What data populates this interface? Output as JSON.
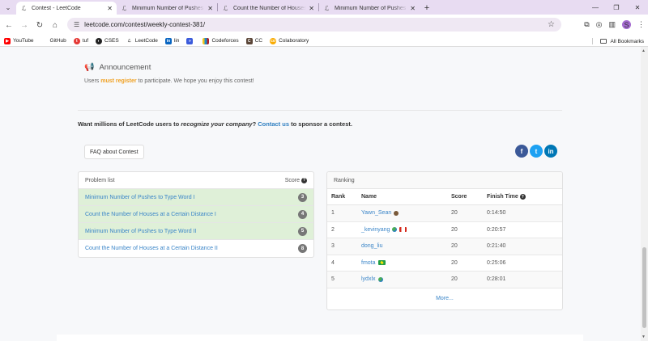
{
  "browser": {
    "tabs": [
      {
        "title": "Contest - LeetCode",
        "active": true
      },
      {
        "title": "Minimum Number of Pushes to",
        "active": false
      },
      {
        "title": "Count the Number of Houses a",
        "active": false
      },
      {
        "title": "Minimum Number of Pushes to",
        "active": false
      }
    ],
    "url": "leetcode.com/contest/weekly-contest-381/",
    "profile_initial": "S",
    "bookmarks": [
      {
        "label": "YouTube",
        "color": "#ff0000"
      },
      {
        "label": "GitHub",
        "color": "#24292e"
      },
      {
        "label": "tuf",
        "color": "#e53935"
      },
      {
        "label": "CSES",
        "color": "#222"
      },
      {
        "label": "LeetCode",
        "color": "#f89f1b"
      },
      {
        "label": "lin",
        "color": "#0a66c2"
      },
      {
        "label": "",
        "color": "#3b5bdb"
      },
      {
        "label": "Codeforces",
        "color": "#1f8acb"
      },
      {
        "label": "CC",
        "color": "#5b4638"
      },
      {
        "label": "Colaboratory",
        "color": "#f9ab00"
      }
    ],
    "all_bookmarks": "All Bookmarks"
  },
  "announcement": {
    "title": "Announcement",
    "prefix": "Users ",
    "must": "must",
    "register": "register",
    "suffix": " to participate. We hope you enjoy this contest!"
  },
  "sponsor": {
    "prefix": "Want millions of LeetCode users to ",
    "emph": "recognize your company",
    "mid": "? ",
    "link": "Contact us",
    "suffix": " to sponsor a contest."
  },
  "faq_button": "FAQ about Contest",
  "problem_list": {
    "header": "Problem list",
    "score_header": "Score",
    "items": [
      {
        "name": "Minimum Number of Pushes to Type Word I",
        "score": "3",
        "solved": true
      },
      {
        "name": "Count the Number of Houses at a Certain Distance I",
        "score": "4",
        "solved": true
      },
      {
        "name": "Minimum Number of Pushes to Type Word II",
        "score": "5",
        "solved": true
      },
      {
        "name": "Count the Number of Houses at a Certain Distance II",
        "score": "8",
        "solved": false
      }
    ]
  },
  "ranking": {
    "header": "Ranking",
    "columns": {
      "rank": "Rank",
      "name": "Name",
      "score": "Score",
      "time": "Finish Time"
    },
    "rows": [
      {
        "rank": "1",
        "name": "Yawn_Sean",
        "score": "20",
        "time": "0:14:50"
      },
      {
        "rank": "2",
        "name": "_kevinyang",
        "score": "20",
        "time": "0:20:57"
      },
      {
        "rank": "3",
        "name": "dong_liu",
        "score": "20",
        "time": "0:21:40"
      },
      {
        "rank": "4",
        "name": "fmota",
        "score": "20",
        "time": "0:25:06"
      },
      {
        "rank": "5",
        "name": "lydxlx",
        "score": "20",
        "time": "0:28:01"
      }
    ],
    "more": "More..."
  }
}
